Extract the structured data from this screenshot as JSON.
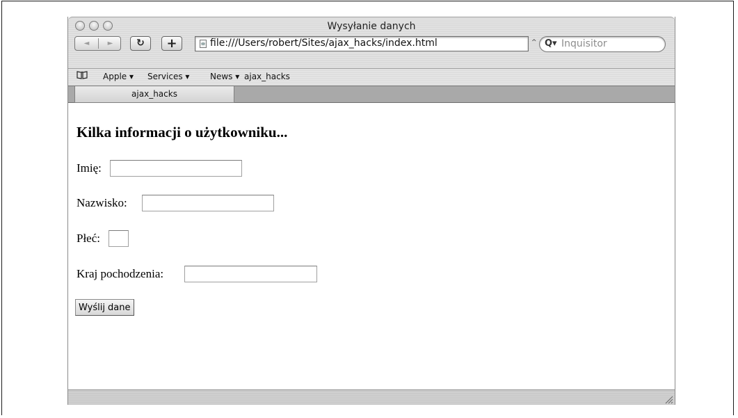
{
  "window": {
    "title": "Wysyłanie danych"
  },
  "toolbar": {
    "back_icon": "back-arrow-icon",
    "forward_icon": "forward-arrow-icon",
    "back_glyph": "◄",
    "forward_glyph": "►",
    "reload_glyph": "↻",
    "add_bookmark_glyph": "+",
    "url": "file:///Users/robert/Sites/ajax_hacks/index.html",
    "url_dropdown_glyph": "^",
    "search_placeholder": "Inquisitor",
    "search_icon_glyph": "Q▾"
  },
  "bookmarks": {
    "items": [
      {
        "label": "Apple ▾"
      },
      {
        "label": "Services ▾"
      },
      {
        "label": "News ▾"
      },
      {
        "label": "ajax_hacks"
      }
    ]
  },
  "tabs": [
    {
      "label": "ajax_hacks"
    }
  ],
  "page": {
    "heading": "Kilka informacji o użytkowniku...",
    "fields": [
      {
        "label": "Imię:",
        "value": ""
      },
      {
        "label": "Nazwisko:",
        "value": ""
      },
      {
        "label": "Płeć:",
        "value": ""
      },
      {
        "label": "Kraj pochodzenia:",
        "value": ""
      }
    ],
    "submit_label": "Wyślij dane"
  }
}
